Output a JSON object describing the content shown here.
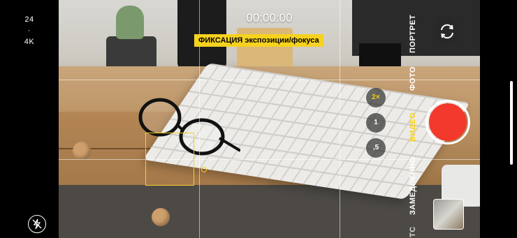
{
  "status": {
    "fps": "24",
    "separator": "·",
    "resolution": "4K"
  },
  "icons": {
    "flash": "flash-off-icon",
    "switch_camera": "camera-switch-icon"
  },
  "timer": "00:00:00",
  "lock_badge": "ФИКСАЦИЯ экспозиции/фокуса",
  "zoom": [
    {
      "label": "2×",
      "active": true
    },
    {
      "label": "1",
      "active": false
    },
    {
      "label": ",5",
      "active": false
    }
  ],
  "modes": [
    {
      "label": "ПОРТРЕТ",
      "active": false
    },
    {
      "label": "ФОТО",
      "active": false
    },
    {
      "label": "ВИДЕО",
      "active": true
    },
    {
      "label": "ЗАМЕДЛЕННО",
      "active": false
    },
    {
      "label": "ТС",
      "active": false
    }
  ],
  "colors": {
    "accent": "#f7d21e",
    "record": "#f2392b"
  }
}
